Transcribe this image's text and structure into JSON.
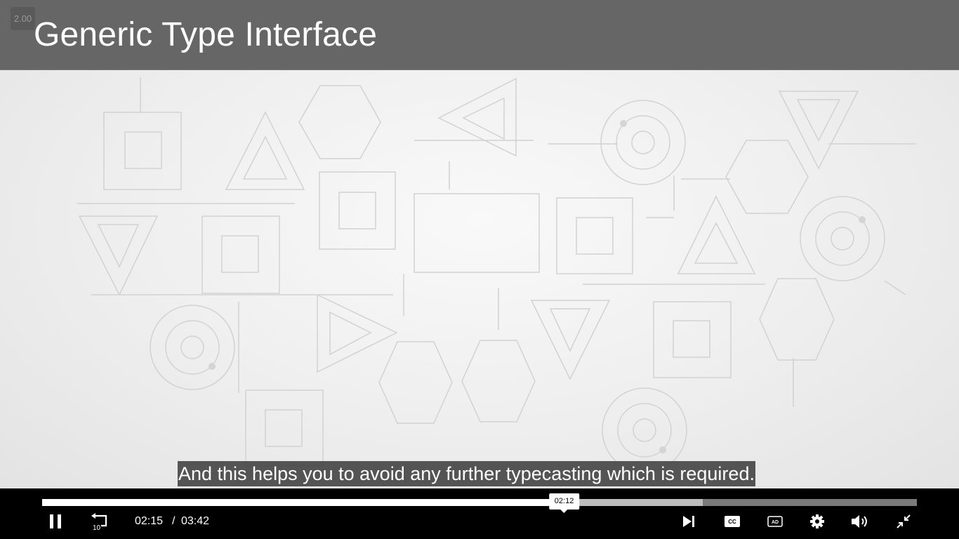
{
  "slide": {
    "title": "Generic Type Interface",
    "speed_label": "2.00"
  },
  "caption": {
    "text": "And this helps you to avoid any further typecasting which is required."
  },
  "progress": {
    "played_fraction": 0.608,
    "buffered_fraction": 0.755,
    "hover_time": "02:12"
  },
  "time": {
    "current": "02:15",
    "separator": "/",
    "duration": "03:42"
  },
  "controls": {
    "pause_icon": "pause-icon",
    "replay_icon": "replay-10-icon",
    "replay_label": "10",
    "next_icon": "skip-next-icon",
    "cc_label": "CC",
    "ad_label": "AD",
    "settings_icon": "gear-icon",
    "volume_icon": "volume-icon",
    "fullscreen_icon": "exit-fullscreen-icon"
  },
  "colors": {
    "title_bar": "#666666",
    "controls_bg": "#000000",
    "caption_bg": "#464646"
  }
}
